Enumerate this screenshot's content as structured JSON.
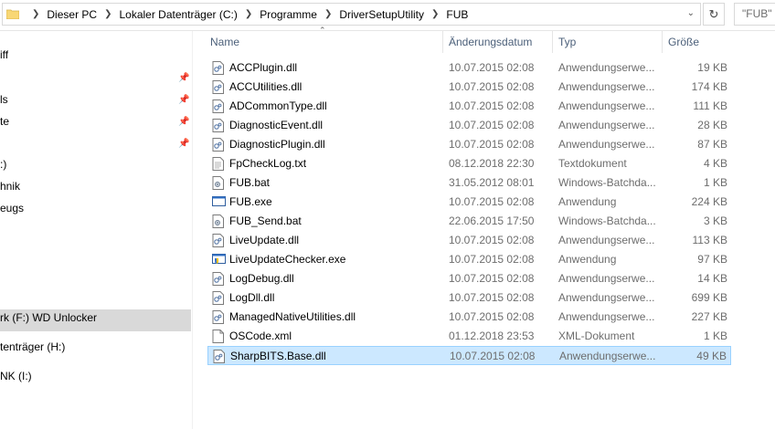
{
  "address": {
    "crumbs": [
      "Dieser PC",
      "Lokaler Datenträger (C:)",
      "Programme",
      "DriverSetupUtility",
      "FUB"
    ],
    "refresh_icon": "refresh-icon",
    "search_placeholder": "\"FUB\" d"
  },
  "nav": {
    "items": [
      {
        "label": "iff",
        "pinned": false
      },
      {
        "label": "ls",
        "pinned": true
      },
      {
        "label": "te",
        "pinned": true
      },
      {
        "label": ":)",
        "pinned": false
      },
      {
        "label": "hnik",
        "pinned": false
      },
      {
        "label": "eugs",
        "pinned": false
      },
      {
        "label": "rk (F:) WD Unlocker",
        "pinned": false
      },
      {
        "label": "tenträger (H:)",
        "pinned": false
      },
      {
        "label": "NK (I:)",
        "pinned": false
      }
    ]
  },
  "columns": {
    "name": "Name",
    "date": "Änderungsdatum",
    "type": "Typ",
    "size": "Größe"
  },
  "files": [
    {
      "name": "ACCPlugin.dll",
      "date": "10.07.2015 02:08",
      "type": "Anwendungserwe...",
      "size": "19 KB",
      "icon": "dll-icon"
    },
    {
      "name": "ACCUtilities.dll",
      "date": "10.07.2015 02:08",
      "type": "Anwendungserwe...",
      "size": "174 KB",
      "icon": "dll-icon"
    },
    {
      "name": "ADCommonType.dll",
      "date": "10.07.2015 02:08",
      "type": "Anwendungserwe...",
      "size": "111 KB",
      "icon": "dll-icon"
    },
    {
      "name": "DiagnosticEvent.dll",
      "date": "10.07.2015 02:08",
      "type": "Anwendungserwe...",
      "size": "28 KB",
      "icon": "dll-icon"
    },
    {
      "name": "DiagnosticPlugin.dll",
      "date": "10.07.2015 02:08",
      "type": "Anwendungserwe...",
      "size": "87 KB",
      "icon": "dll-icon"
    },
    {
      "name": "FpCheckLog.txt",
      "date": "08.12.2018 22:30",
      "type": "Textdokument",
      "size": "4 KB",
      "icon": "txt-icon"
    },
    {
      "name": "FUB.bat",
      "date": "31.05.2012 08:01",
      "type": "Windows-Batchda...",
      "size": "1 KB",
      "icon": "bat-icon"
    },
    {
      "name": "FUB.exe",
      "date": "10.07.2015 02:08",
      "type": "Anwendung",
      "size": "224 KB",
      "icon": "exe-icon"
    },
    {
      "name": "FUB_Send.bat",
      "date": "22.06.2015 17:50",
      "type": "Windows-Batchda...",
      "size": "3 KB",
      "icon": "bat-icon"
    },
    {
      "name": "LiveUpdate.dll",
      "date": "10.07.2015 02:08",
      "type": "Anwendungserwe...",
      "size": "113 KB",
      "icon": "dll-icon"
    },
    {
      "name": "LiveUpdateChecker.exe",
      "date": "10.07.2015 02:08",
      "type": "Anwendung",
      "size": "97 KB",
      "icon": "exe-shield-icon"
    },
    {
      "name": "LogDebug.dll",
      "date": "10.07.2015 02:08",
      "type": "Anwendungserwe...",
      "size": "14 KB",
      "icon": "dll-icon"
    },
    {
      "name": "LogDll.dll",
      "date": "10.07.2015 02:08",
      "type": "Anwendungserwe...",
      "size": "699 KB",
      "icon": "dll-icon"
    },
    {
      "name": "ManagedNativeUtilities.dll",
      "date": "10.07.2015 02:08",
      "type": "Anwendungserwe...",
      "size": "227 KB",
      "icon": "dll-icon"
    },
    {
      "name": "OSCode.xml",
      "date": "01.12.2018 23:53",
      "type": "XML-Dokument",
      "size": "1 KB",
      "icon": "xml-icon"
    },
    {
      "name": "SharpBITS.Base.dll",
      "date": "10.07.2015 02:08",
      "type": "Anwendungserwe...",
      "size": "49 KB",
      "icon": "dll-icon",
      "selected": true
    }
  ],
  "colors": {
    "selection_bg": "#cce8ff",
    "selection_border": "#99d1ff",
    "header_text": "#4c607a",
    "nav_selected": "#d9d9d9"
  }
}
